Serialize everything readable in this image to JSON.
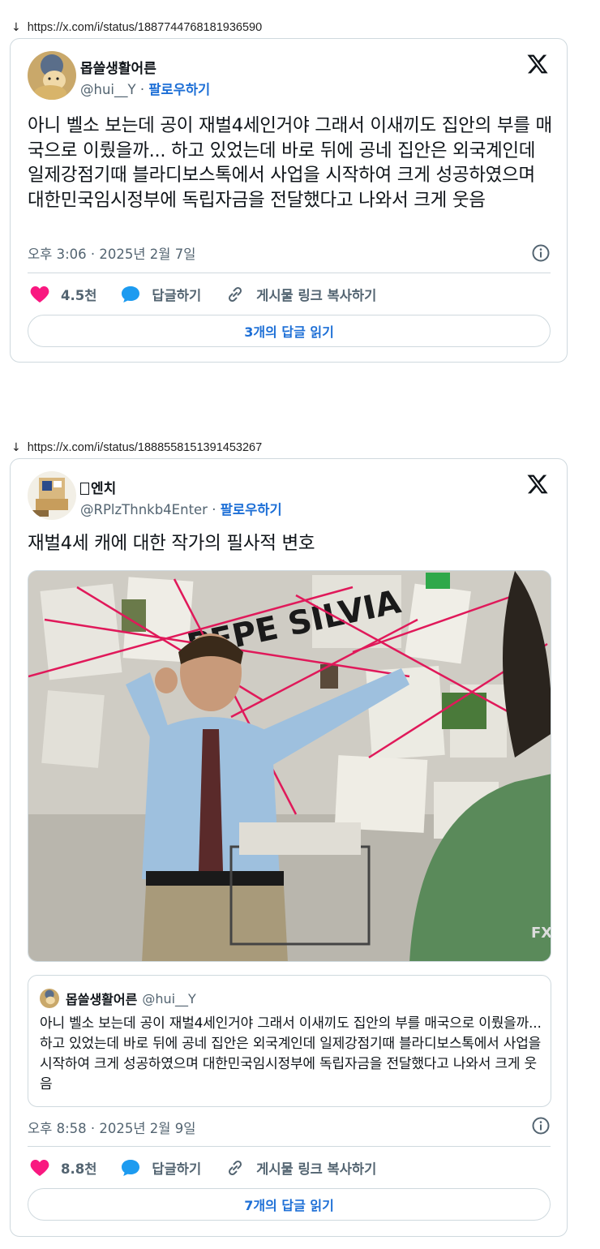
{
  "tweets": [
    {
      "url": "https://x.com/i/status/1887744768181936590",
      "author_name": "몹쓸생활어른",
      "handle": "@hui__Y",
      "separator": "·",
      "follow_label": "팔로우하기",
      "text": "아니 벨소 보는데 공이 재벌4세인거야 그래서 이새끼도 집안의 부를 매국으로 이뤘을까... 하고 있었는데 바로 뒤에 공네 집안은 외국계인데 일제강점기때 블라디보스톡에서 사업을 시작하여 크게 성공하였으며 대한민국임시정부에 독립자금을 전달했다고 나와서 크게 웃음",
      "timestamp": "오후 3:06 · 2025년 2월 7일",
      "likes": "4.5천",
      "reply_label": "답글하기",
      "copy_link_label": "게시물 링크 복사하기",
      "read_replies_label": "3개의 답글 읽기"
    },
    {
      "url": "https://x.com/i/status/1888558151391453267",
      "author_name": "엔치",
      "handle": "@RPlzThnkb4Enter",
      "separator": "·",
      "follow_label": "팔로우하기",
      "text": "재벌4세 캐에 대한 작가의 필사적 변호",
      "quote": {
        "author_name": "몹쓸생활어른",
        "handle": "@hui__Y",
        "text": "아니 벨소 보는데 공이 재벌4세인거야 그래서 이새끼도 집안의 부를 매국으로 이뤘을까... 하고 있었는데 바로 뒤에 공네 집안은 외국계인데 일제강점기때 블라디보스톡에서 사업을 시작하여 크게 성공하였으며 대한민국임시정부에 독립자금을 전달했다고 나와서 크게 웃음"
      },
      "media_caption": "PEPE SILVIA",
      "media_watermark": "FX",
      "timestamp": "오후 8:58 · 2025년 2월 9일",
      "likes": "8.8천",
      "reply_label": "답글하기",
      "copy_link_label": "게시물 링크 복사하기",
      "read_replies_label": "7개의 답글 읽기"
    }
  ],
  "icons": {
    "download": "down-arrow-icon",
    "x_logo": "x-logo-icon",
    "info": "info-icon",
    "heart": "heart-icon",
    "reply": "speech-bubble-icon",
    "link": "link-icon"
  },
  "colors": {
    "like": "#f91880",
    "reply": "#1d9bf0",
    "follow": "#1d6fd6",
    "muted": "#536471",
    "border": "#cfd9de"
  }
}
